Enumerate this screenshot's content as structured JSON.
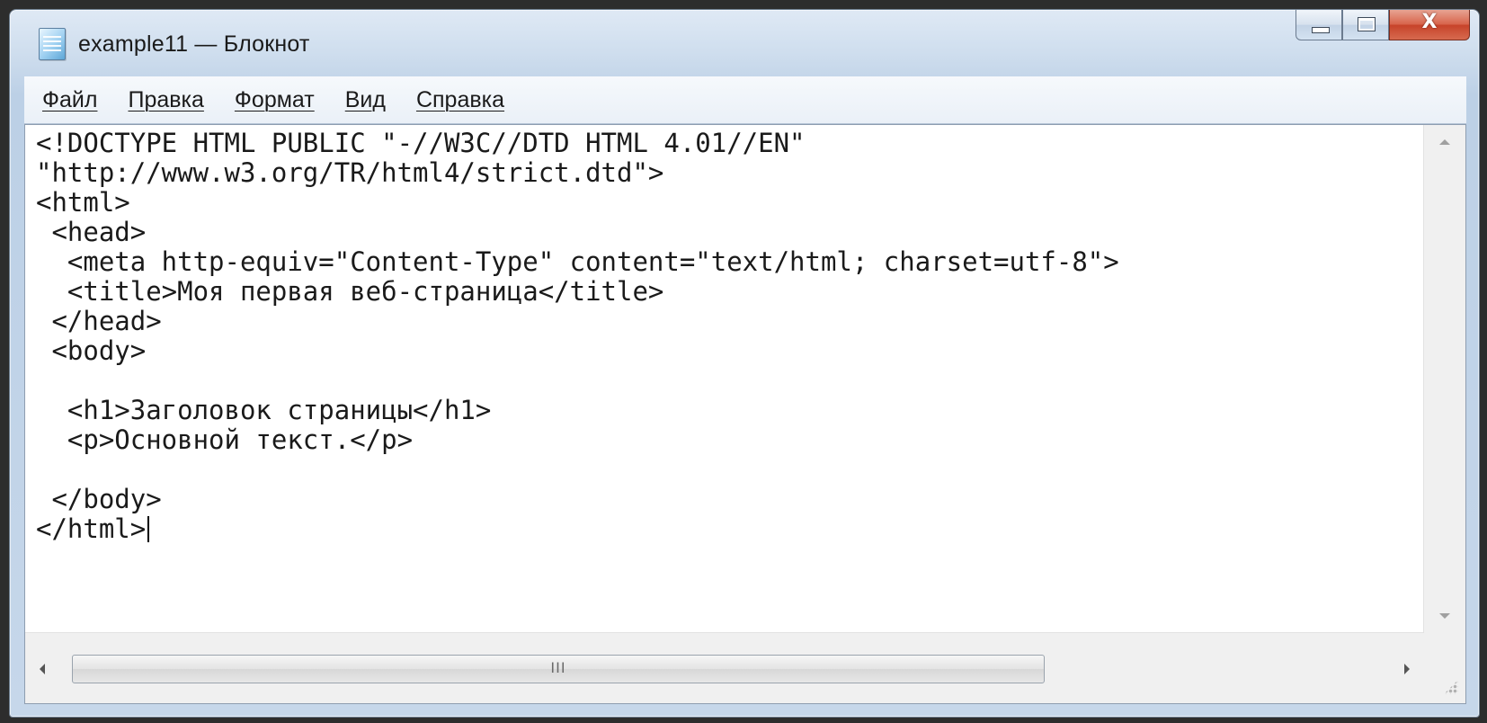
{
  "window": {
    "title": "example11 — Блокнот",
    "app_icon": "notepad-icon",
    "caption": {
      "minimize_icon": "minimize-icon",
      "maximize_icon": "maximize-icon",
      "close_label": "X"
    }
  },
  "menu": {
    "items": [
      {
        "label": "Файл"
      },
      {
        "label": "Правка"
      },
      {
        "label": "Формат"
      },
      {
        "label": "Вид"
      },
      {
        "label": "Справка"
      }
    ]
  },
  "editor": {
    "lines": [
      "<!DOCTYPE HTML PUBLIC \"-//W3C//DTD HTML 4.01//EN\"",
      "\"http://www.w3.org/TR/html4/strict.dtd\">",
      "<html>",
      " <head>",
      "  <meta http-equiv=\"Content-Type\" content=\"text/html; charset=utf-8\">",
      "  <title>Моя первая веб-страница</title>",
      " </head>",
      " <body>",
      "",
      "  <h1>Заголовок страницы</h1>",
      "  <p>Основной текст.</p>",
      "",
      " </body>",
      "</html>"
    ],
    "caret_line": 13
  },
  "scrollbars": {
    "horizontal_grip": "III"
  },
  "colors": {
    "close_button": "#d0553a",
    "window_frame": "#c6d7ea",
    "editor_background": "#ffffff"
  }
}
